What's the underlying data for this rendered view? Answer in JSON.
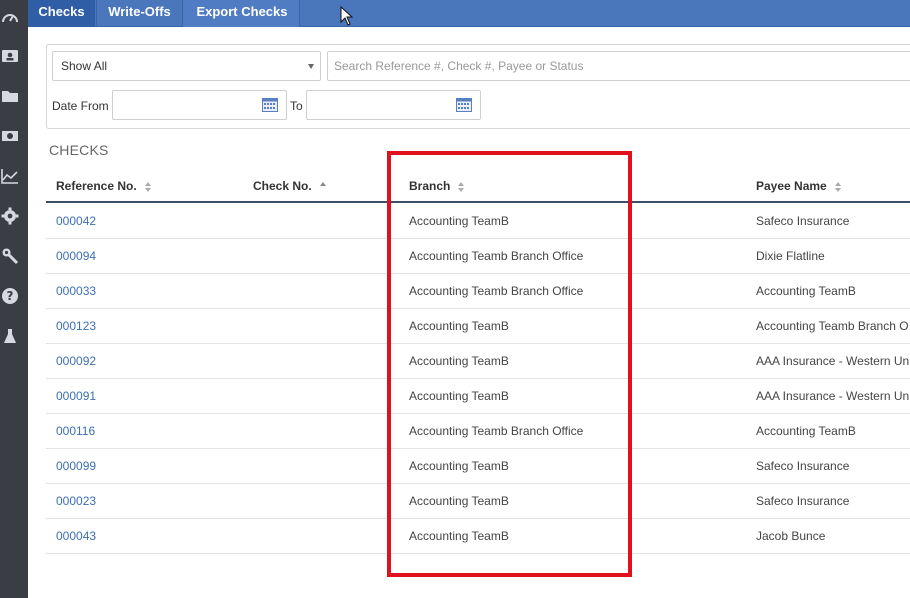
{
  "tabs": [
    {
      "label": "Checks",
      "active": true
    },
    {
      "label": "Write-Offs",
      "active": false
    },
    {
      "label": "Export Checks",
      "active": false
    }
  ],
  "rail_icons": [
    "dashboard-icon",
    "contacts-icon",
    "folder-icon",
    "money-icon",
    "chart-icon",
    "gear-icon",
    "wrench-icon",
    "help-icon",
    "lab-flask-icon"
  ],
  "filters": {
    "status_select": "Show All",
    "search_placeholder": "Search Reference #, Check #, Payee or Status",
    "date_from_label": "Date From",
    "to_label": "To"
  },
  "section_title": "CHECKS",
  "columns": {
    "reference": "Reference No.",
    "check": "Check No.",
    "branch": "Branch",
    "payee": "Payee Name"
  },
  "rows": [
    {
      "ref": "000042",
      "check": "",
      "branch": "Accounting TeamB",
      "payee": "Safeco Insurance"
    },
    {
      "ref": "000094",
      "check": "",
      "branch": "Accounting Teamb Branch Office",
      "payee": "Dixie Flatline"
    },
    {
      "ref": "000033",
      "check": "",
      "branch": "Accounting Teamb Branch Office",
      "payee": "Accounting TeamB"
    },
    {
      "ref": "000123",
      "check": "",
      "branch": "Accounting TeamB",
      "payee": "Accounting Teamb Branch O"
    },
    {
      "ref": "000092",
      "check": "",
      "branch": "Accounting TeamB",
      "payee": "AAA Insurance - Western Un"
    },
    {
      "ref": "000091",
      "check": "",
      "branch": "Accounting TeamB",
      "payee": "AAA Insurance - Western Un"
    },
    {
      "ref": "000116",
      "check": "",
      "branch": "Accounting Teamb Branch Office",
      "payee": "Accounting TeamB"
    },
    {
      "ref": "000099",
      "check": "",
      "branch": "Accounting TeamB",
      "payee": "Safeco Insurance"
    },
    {
      "ref": "000023",
      "check": "",
      "branch": "Accounting TeamB",
      "payee": "Safeco Insurance"
    },
    {
      "ref": "000043",
      "check": "",
      "branch": "Accounting TeamB",
      "payee": "Jacob Bunce"
    }
  ],
  "colors": {
    "tabbar": "#4a76bc",
    "tab_active": "#2f5ea7",
    "rail": "#3a3d44",
    "link": "#3d6fb4",
    "highlight": "#e0101c"
  }
}
